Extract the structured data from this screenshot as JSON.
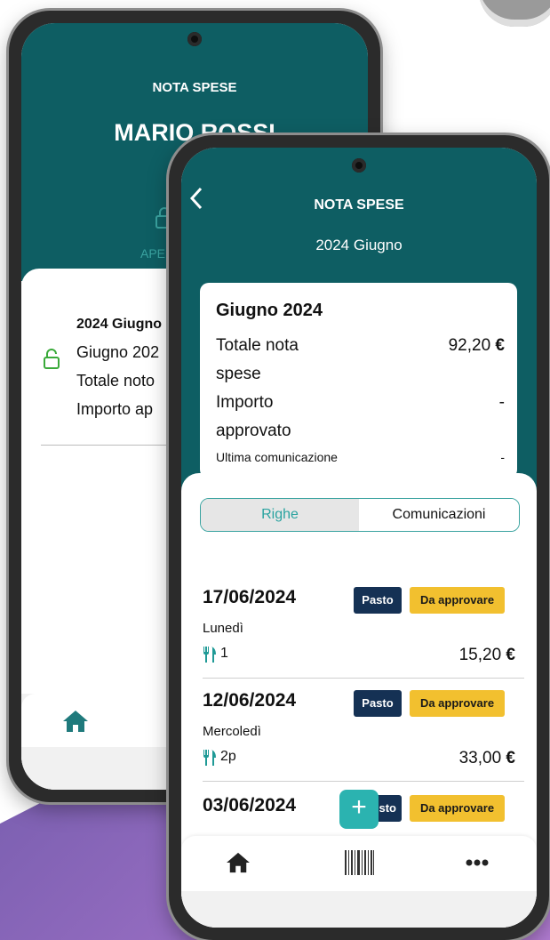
{
  "colors": {
    "teal": "#0e5e63",
    "accent": "#2bb3b0",
    "badge_dark": "#153154",
    "badge_yellow": "#f2c02f"
  },
  "back": {
    "title": "NOTA SPESE",
    "name": "MARIO ROSSI",
    "status_label": "APERT",
    "status_icon": "unlock-icon",
    "item": {
      "period": "2024 Giugno",
      "month": "Giugno 202",
      "total": "Totale noto",
      "approved": "Importo ap"
    },
    "nav_icon": "home-icon"
  },
  "front": {
    "title": "NOTA SPESE",
    "subtitle": "2024 Giugno",
    "back_icon": "chevron-left-icon",
    "summary": {
      "title": "Giugno 2024",
      "total_label_1": "Totale nota",
      "total_label_2": "spese",
      "total_value": "92,20",
      "currency": "€",
      "approved_label_1": "Importo",
      "approved_label_2": "approvato",
      "approved_value": "-",
      "last_comm_label": "Ultima comunicazione",
      "last_comm_value": "-"
    },
    "tabs": [
      "Righe",
      "Comunicazioni"
    ],
    "entries": [
      {
        "date": "17/06/2024",
        "day": "Lunedì",
        "count": "1",
        "amount": "15,20",
        "type": "Pasto",
        "status": "Da approvare"
      },
      {
        "date": "12/06/2024",
        "day": "Mercoledì",
        "count": "2p",
        "amount": "33,00",
        "type": "Pasto",
        "status": "Da approvare"
      },
      {
        "date": "03/06/2024",
        "type": "sto",
        "status": "Da approvare"
      }
    ],
    "fab": "+",
    "nav": [
      "home-icon",
      "barcode-icon",
      "more-icon"
    ]
  }
}
